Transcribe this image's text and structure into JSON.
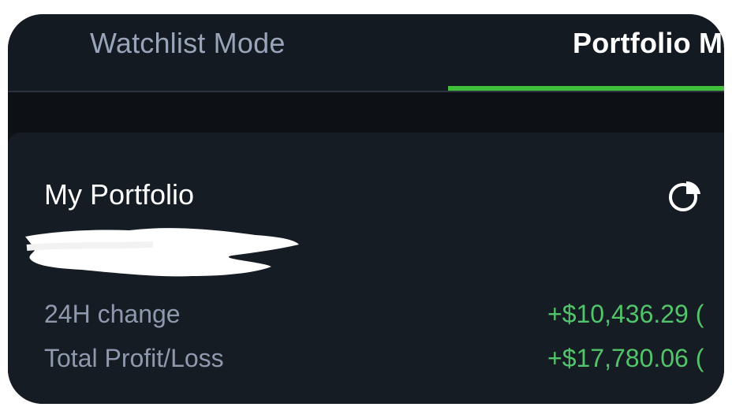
{
  "tabs": [
    {
      "label": "Watchlist Mode",
      "active": false
    },
    {
      "label": "Portfolio Mode",
      "active": true
    }
  ],
  "colors": {
    "background": "#0f1217",
    "card": "#161c24",
    "accent_green": "#3fbf3a",
    "positive_text": "#52c46a",
    "muted_text": "#8f99ad"
  },
  "portfolio": {
    "title": "My Portfolio",
    "icon": "pie-chart-icon",
    "rows": [
      {
        "label": "24H change",
        "value": "+$10,436.29 ("
      },
      {
        "label": "Total Profit/Loss",
        "value": "+$17,780.06 ("
      }
    ]
  }
}
